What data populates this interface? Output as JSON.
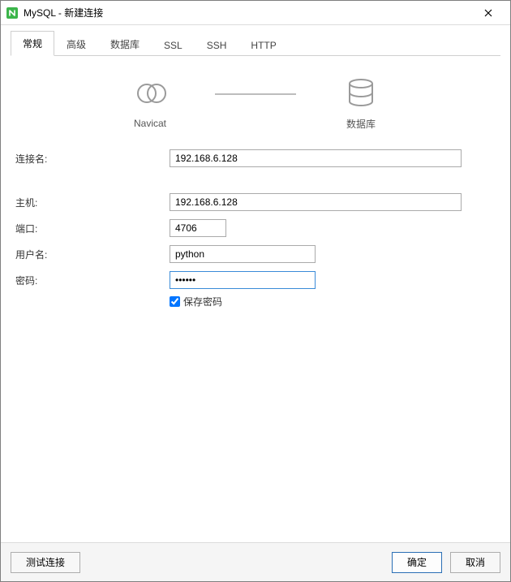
{
  "window": {
    "title": "MySQL - 新建连接"
  },
  "tabs": [
    {
      "label": "常规",
      "active": true
    },
    {
      "label": "高级",
      "active": false
    },
    {
      "label": "数据库",
      "active": false
    },
    {
      "label": "SSL",
      "active": false
    },
    {
      "label": "SSH",
      "active": false
    },
    {
      "label": "HTTP",
      "active": false
    }
  ],
  "diagram": {
    "left_label": "Navicat",
    "right_label": "数据库"
  },
  "form": {
    "connection_name": {
      "label": "连接名:",
      "value": "192.168.6.128"
    },
    "host": {
      "label": "主机:",
      "value": "192.168.6.128"
    },
    "port": {
      "label": "端口:",
      "value": "4706"
    },
    "username": {
      "label": "用户名:",
      "value": "python"
    },
    "password": {
      "label": "密码:",
      "value": "••••••"
    },
    "save_password": {
      "label": "保存密码",
      "checked": true
    }
  },
  "footer": {
    "test": "测试连接",
    "ok": "确定",
    "cancel": "取消"
  }
}
